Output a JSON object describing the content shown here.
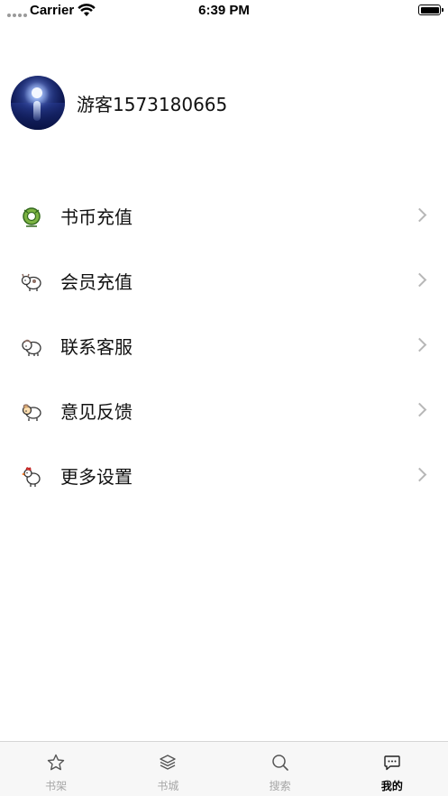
{
  "status_bar": {
    "carrier": "Carrier",
    "time": "6:39 PM",
    "battery_level": 1.0
  },
  "profile": {
    "username": "游客1573180665",
    "avatar_icon": "moon-over-sea-avatar"
  },
  "menu": {
    "items": [
      {
        "label": "书币充值",
        "icon": "green-coin-icon"
      },
      {
        "label": "会员充值",
        "icon": "cow-mascot-icon"
      },
      {
        "label": "联系客服",
        "icon": "sheep-mascot-icon"
      },
      {
        "label": "意见反馈",
        "icon": "ram-mascot-icon"
      },
      {
        "label": "更多设置",
        "icon": "rooster-mascot-icon"
      }
    ]
  },
  "tab_bar": {
    "tabs": [
      {
        "label": "书架",
        "icon": "star-icon",
        "active": false
      },
      {
        "label": "书城",
        "icon": "layers-icon",
        "active": false
      },
      {
        "label": "搜索",
        "icon": "search-icon",
        "active": false
      },
      {
        "label": "我的",
        "icon": "chat-bubble-icon",
        "active": true
      }
    ]
  },
  "colors": {
    "background": "#ffffff",
    "tab_bar_bg": "#f7f7f7",
    "inactive_tab": "#a6a6a6",
    "active_tab": "#000000",
    "chevron": "#b7b7b7"
  }
}
